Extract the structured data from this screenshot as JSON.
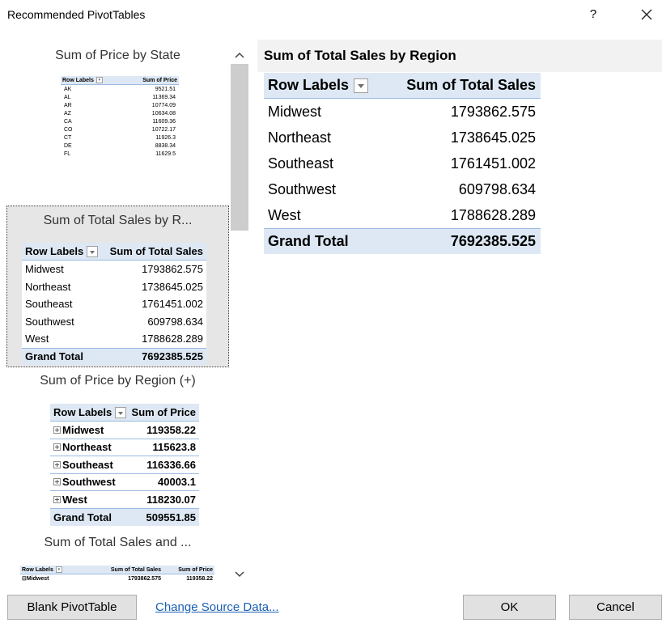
{
  "dialog": {
    "title": "Recommended PivotTables",
    "help_label": "?"
  },
  "recommendations": [
    {
      "title": "Sum of Price by State",
      "headers": [
        "Row Labels",
        "Sum of Price"
      ],
      "rows": [
        [
          "AK",
          "9521.51"
        ],
        [
          "AL",
          "11369.34"
        ],
        [
          "AR",
          "10774.09"
        ],
        [
          "AZ",
          "10634.08"
        ],
        [
          "CA",
          "11609.36"
        ],
        [
          "CO",
          "10722.17"
        ],
        [
          "CT",
          "11926.3"
        ],
        [
          "DE",
          "8838.34"
        ],
        [
          "FL",
          "11629.5"
        ]
      ]
    },
    {
      "title": "Sum of Total Sales by R...",
      "selected": true,
      "headers": [
        "Row Labels",
        "Sum of Total Sales"
      ],
      "rows": [
        [
          "Midwest",
          "1793862.575"
        ],
        [
          "Northeast",
          "1738645.025"
        ],
        [
          "Southeast",
          "1761451.002"
        ],
        [
          "Southwest",
          "609798.634"
        ],
        [
          "West",
          "1788628.289"
        ]
      ],
      "total": [
        "Grand Total",
        "7692385.525"
      ]
    },
    {
      "title": "Sum of Price by Region (+)",
      "headers": [
        "Row Labels",
        "Sum of Price"
      ],
      "rows": [
        [
          "Midwest",
          "119358.22"
        ],
        [
          "Northeast",
          "115623.8"
        ],
        [
          "Southeast",
          "116336.66"
        ],
        [
          "Southwest",
          "40003.1"
        ],
        [
          "West",
          "118230.07"
        ]
      ],
      "total": [
        "Grand Total",
        "509551.85"
      ]
    },
    {
      "title": "Sum of Total Sales and ...",
      "headers": [
        "Row Labels",
        "Sum of Total Sales",
        "Sum of Price"
      ],
      "rows": [
        [
          "Midwest",
          "1793862.575",
          "119358.22"
        ]
      ]
    }
  ],
  "preview": {
    "title": "Sum of Total Sales by Region",
    "headers": [
      "Row Labels",
      "Sum of Total Sales"
    ],
    "rows": [
      [
        "Midwest",
        "1793862.575"
      ],
      [
        "Northeast",
        "1738645.025"
      ],
      [
        "Southeast",
        "1761451.002"
      ],
      [
        "Southwest",
        "609798.634"
      ],
      [
        "West",
        "1788628.289"
      ]
    ],
    "total": [
      "Grand Total",
      "7692385.525"
    ]
  },
  "footer": {
    "blank_label": "Blank PivotTable",
    "change_source_label": "Change Source Data...",
    "ok_label": "OK",
    "cancel_label": "Cancel"
  },
  "colors": {
    "header_fill": "#dde8f4",
    "header_border": "#9bbbe0",
    "selected_card": "#e6e6e6",
    "link": "#1a5fb4"
  }
}
